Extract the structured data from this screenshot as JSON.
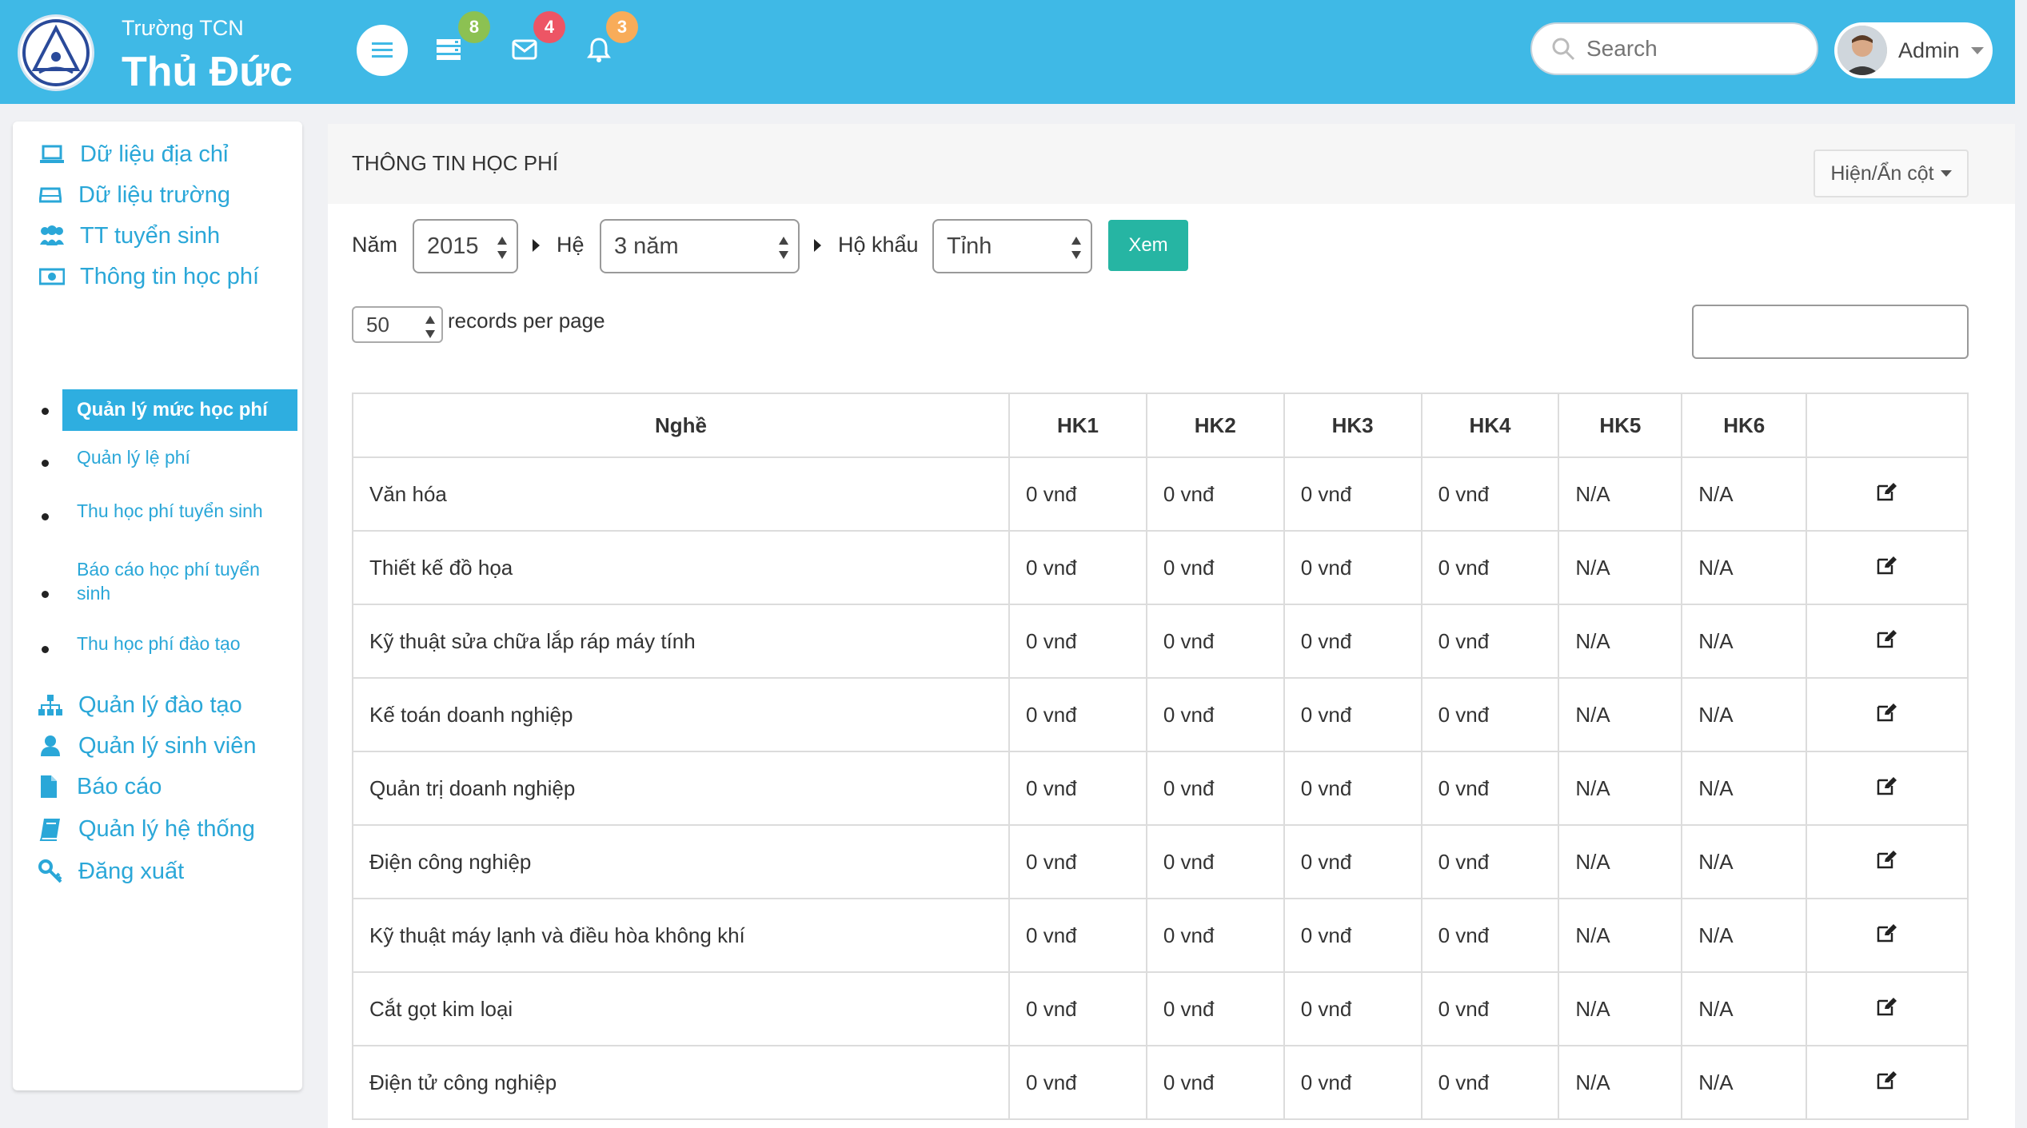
{
  "header": {
    "brand_top": "Trường TCN",
    "brand_main": "Thủ Đức",
    "badges": {
      "list": "8",
      "mail": "4",
      "bell": "3"
    },
    "badge_colors": {
      "list": "#8cc152",
      "mail": "#ed5565",
      "bell": "#f8ac59"
    },
    "search_placeholder": "Search",
    "user_name": "Admin"
  },
  "sidebar": {
    "items": [
      {
        "label": "Dữ liệu địa chỉ",
        "icon": "laptop-icon"
      },
      {
        "label": "Dữ liệu trường",
        "icon": "hdd-icon"
      },
      {
        "label": "TT tuyển sinh",
        "icon": "users-icon"
      },
      {
        "label": "Thông tin học phí",
        "icon": "money-icon"
      },
      {
        "label": "Quản lý đào tạo",
        "icon": "sitemap-icon"
      },
      {
        "label": "Quản lý sinh viên",
        "icon": "user-icon"
      },
      {
        "label": "Báo cáo",
        "icon": "file-icon"
      },
      {
        "label": "Quản lý hệ thống",
        "icon": "book-icon"
      },
      {
        "label": "Đăng xuất",
        "icon": "key-icon"
      }
    ],
    "sub_items": [
      {
        "label": "Quản lý mức học phí",
        "active": true
      },
      {
        "label": "Quản lý lệ phí"
      },
      {
        "label": "Thu học phí tuyển sinh"
      },
      {
        "label": "Báo cáo học phí tuyển sinh"
      },
      {
        "label": "Thu học phí đào tạo"
      }
    ]
  },
  "main": {
    "title": "THÔNG TIN HỌC PHÍ",
    "column_toggle_label": "Hiện/Ẩn cột",
    "filters": {
      "year_label": "Năm",
      "year_value": "2015",
      "he_label": "Hệ",
      "he_value": "3 năm",
      "hokhau_label": "Hộ khẩu",
      "hokhau_value": "Tỉnh",
      "submit_label": "Xem"
    },
    "records_per_page": {
      "value": "50",
      "label": "records per page"
    },
    "table": {
      "headers": [
        "Nghề",
        "HK1",
        "HK2",
        "HK3",
        "HK4",
        "HK5",
        "HK6",
        ""
      ],
      "rows": [
        [
          "Văn hóa",
          "0 vnđ",
          "0 vnđ",
          "0 vnđ",
          "0 vnđ",
          "N/A",
          "N/A"
        ],
        [
          "Thiết kế đồ họa",
          "0 vnđ",
          "0 vnđ",
          "0 vnđ",
          "0 vnđ",
          "N/A",
          "N/A"
        ],
        [
          "Kỹ thuật sửa chữa lắp ráp máy tính",
          "0 vnđ",
          "0 vnđ",
          "0 vnđ",
          "0 vnđ",
          "N/A",
          "N/A"
        ],
        [
          "Kế toán doanh nghiệp",
          "0 vnđ",
          "0 vnđ",
          "0 vnđ",
          "0 vnđ",
          "N/A",
          "N/A"
        ],
        [
          "Quản trị doanh nghiệp",
          "0 vnđ",
          "0 vnđ",
          "0 vnđ",
          "0 vnđ",
          "N/A",
          "N/A"
        ],
        [
          "Điện công nghiệp",
          "0 vnđ",
          "0 vnđ",
          "0 vnđ",
          "0 vnđ",
          "N/A",
          "N/A"
        ],
        [
          "Kỹ thuật máy lạnh và điều hòa không khí",
          "0 vnđ",
          "0 vnđ",
          "0 vnđ",
          "0 vnđ",
          "N/A",
          "N/A"
        ],
        [
          "Cắt gọt kim loại",
          "0 vnđ",
          "0 vnđ",
          "0 vnđ",
          "0 vnđ",
          "N/A",
          "N/A"
        ],
        [
          "Điện tử công nghiệp",
          "0 vnđ",
          "0 vnđ",
          "0 vnđ",
          "0 vnđ",
          "N/A",
          "N/A"
        ]
      ],
      "row_action_icon": "edit-icon"
    }
  }
}
